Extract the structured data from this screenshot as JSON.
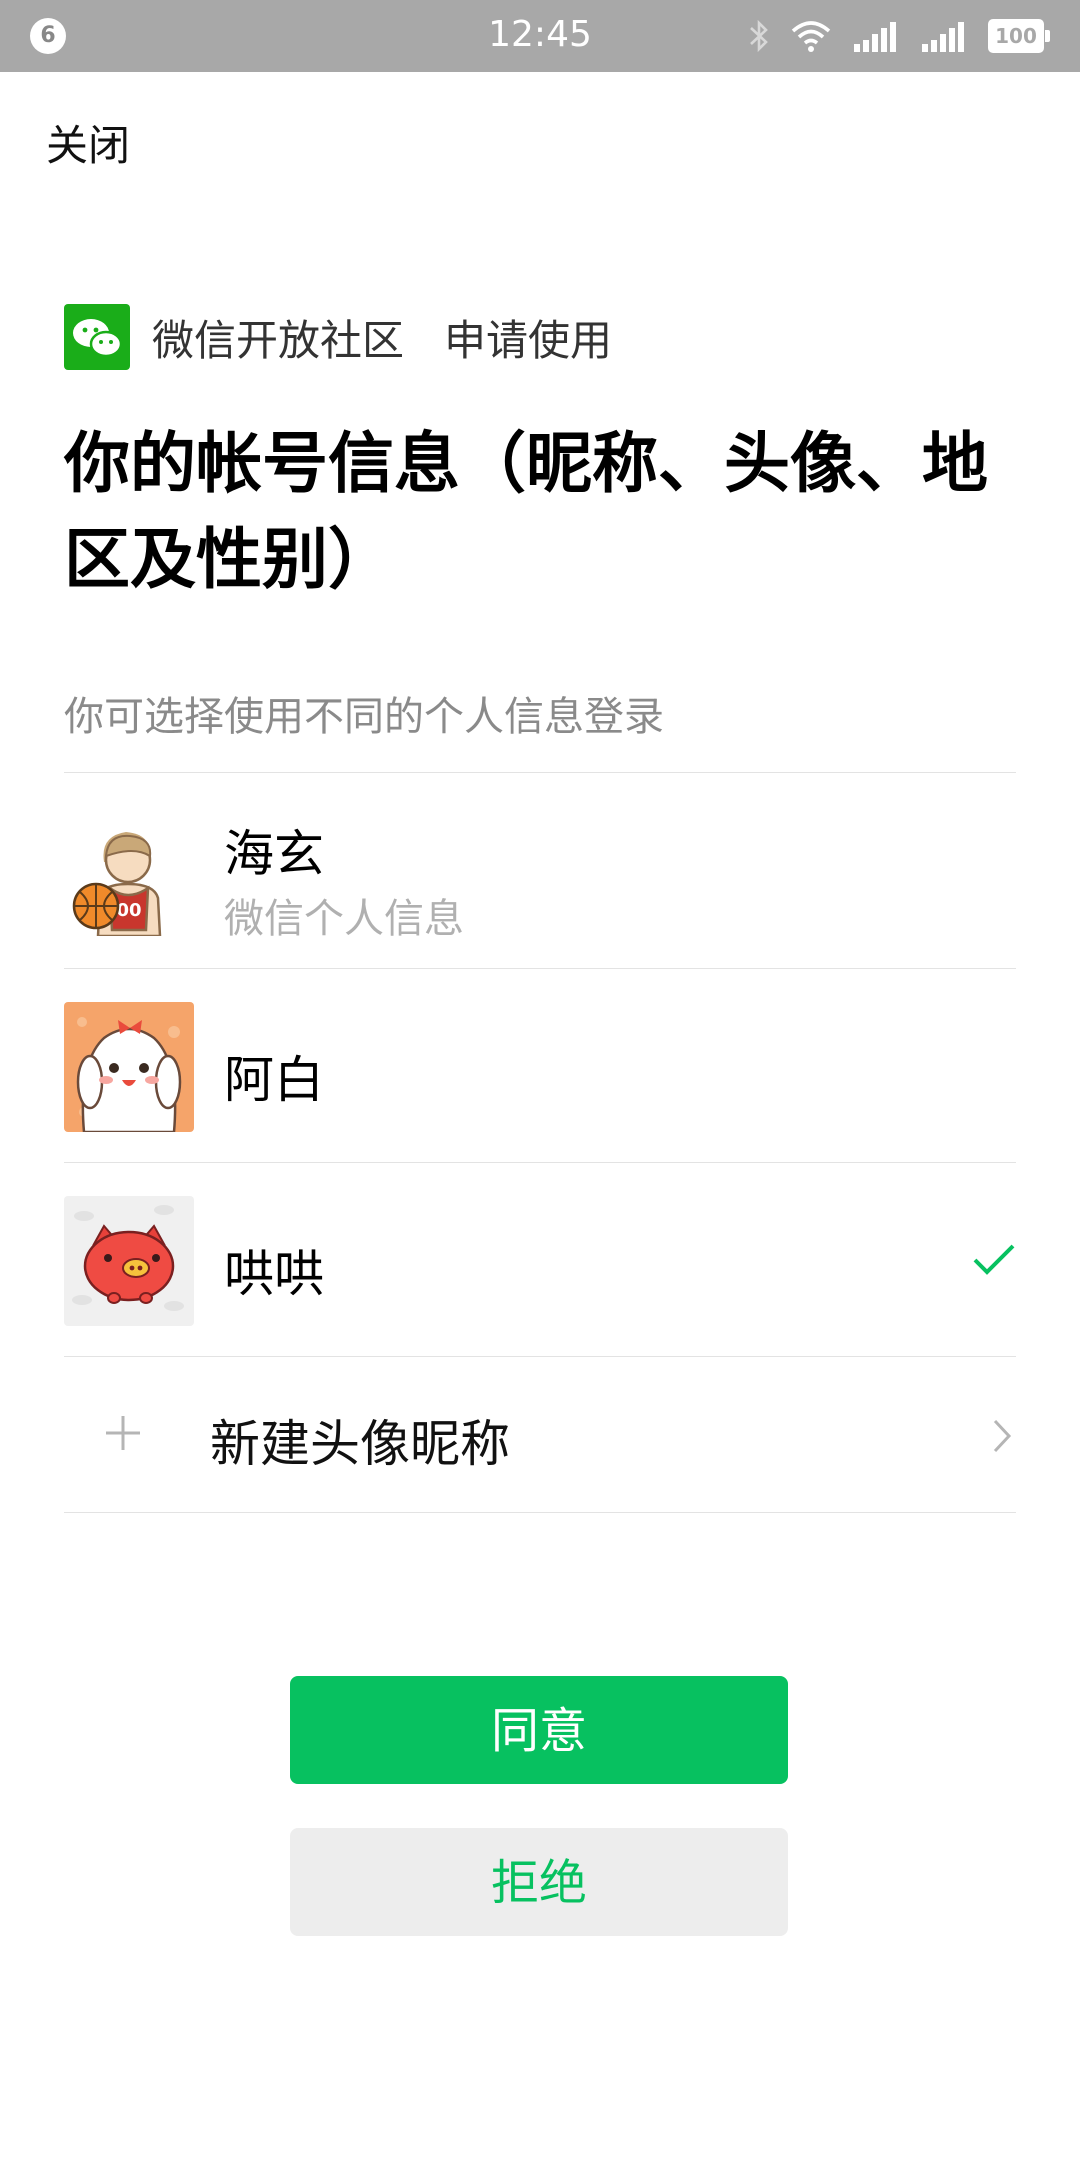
{
  "status_bar": {
    "notification_count": "6",
    "time": "12:45",
    "battery": "100",
    "icons": [
      "bluetooth-icon",
      "wifi-icon",
      "signal-icon",
      "signal-2-icon",
      "battery-icon"
    ]
  },
  "header": {
    "close_label": "关闭"
  },
  "app": {
    "name": "微信开放社区",
    "action": "申请使用",
    "logo_icon": "wechat-logo-icon"
  },
  "page": {
    "title": "你的帐号信息（昵称、头像、地区及性别）",
    "subtitle": "你可选择使用不同的个人信息登录"
  },
  "accounts": [
    {
      "name": "海玄",
      "subtitle": "微信个人信息",
      "avatar": "basketball-player-avatar",
      "selected": false
    },
    {
      "name": "阿白",
      "subtitle": "",
      "avatar": "white-bunny-avatar",
      "selected": false
    },
    {
      "name": "哄哄",
      "subtitle": "",
      "avatar": "red-pig-avatar",
      "selected": true
    }
  ],
  "new_profile": {
    "label": "新建头像昵称"
  },
  "buttons": {
    "agree": "同意",
    "decline": "拒绝"
  },
  "colors": {
    "primary_green": "#07c160",
    "wechat_green": "#1aad19",
    "status_bar": "#a8a8a8"
  }
}
